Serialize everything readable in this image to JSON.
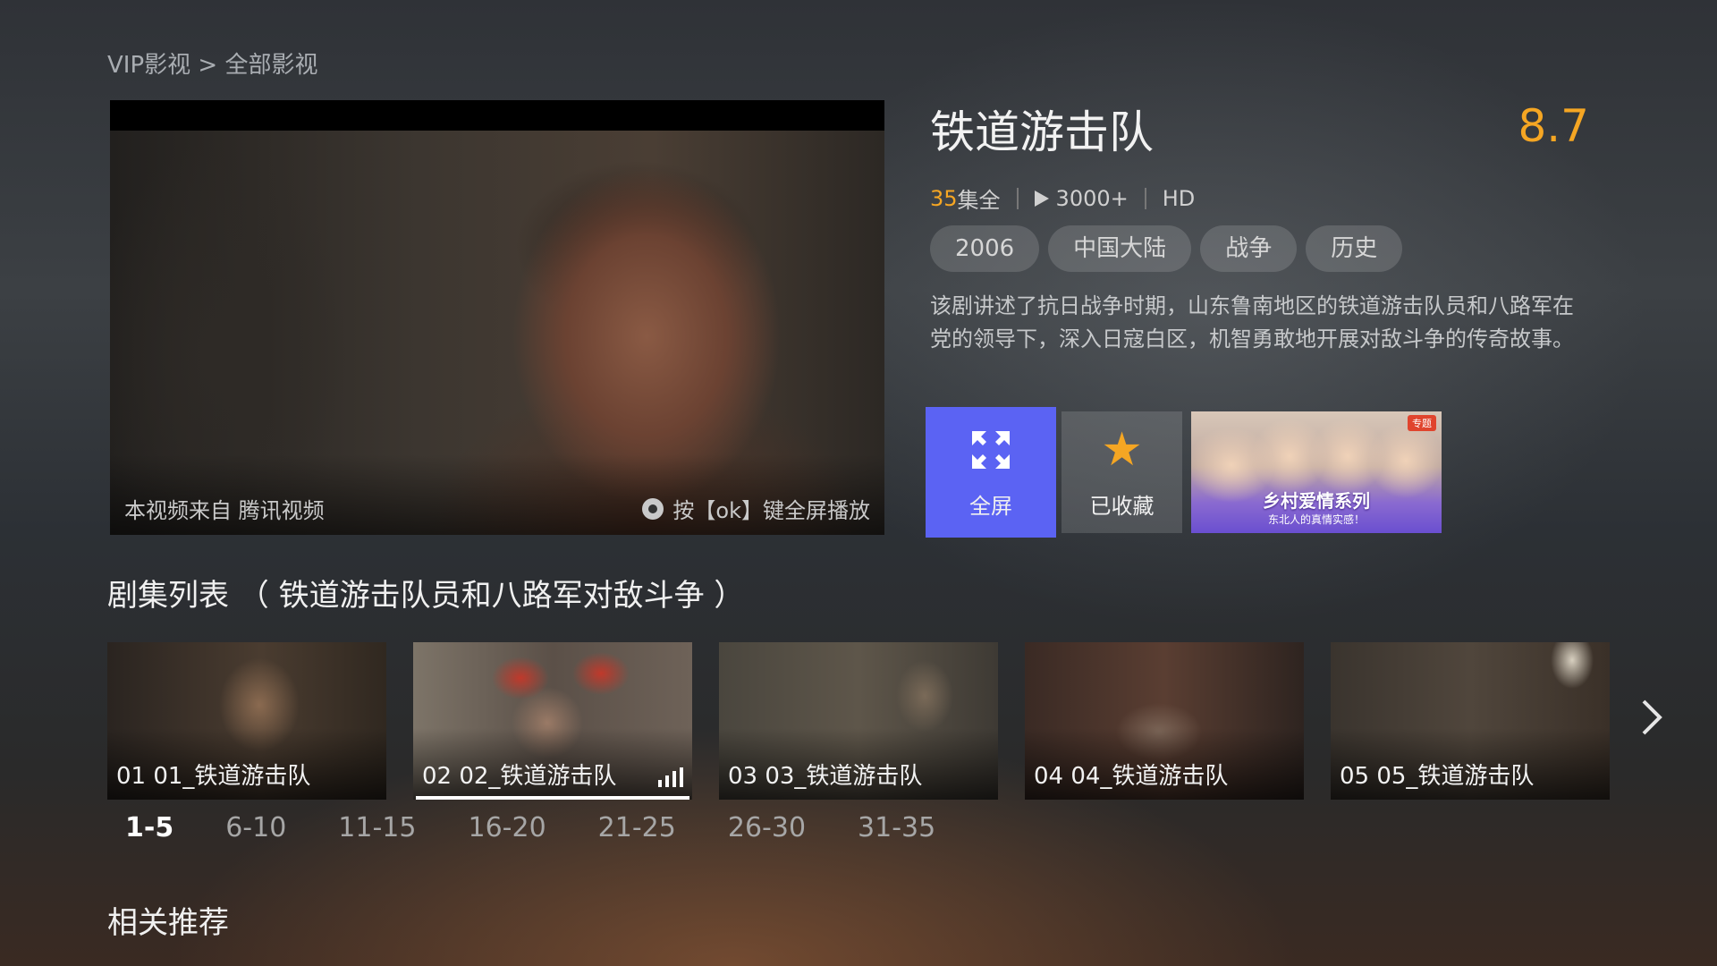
{
  "breadcrumb": "VIP影视 > 全部影视",
  "player": {
    "source_text": "本视频来自 腾讯视频",
    "hint_text": "按【ok】键全屏播放"
  },
  "show": {
    "title": "铁道游击队",
    "score": "8.7",
    "episode_count": "35",
    "episode_suffix": "集全",
    "plays": "3000+",
    "quality": "HD",
    "tags": [
      "2006",
      "中国大陆",
      "战争",
      "历史"
    ],
    "description": "该剧讲述了抗日战争时期，山东鲁南地区的铁道游击队员和八路军在党的领导下，深入日寇白区，机智勇敢地开展对敌斗争的传奇故事。"
  },
  "actions": {
    "fullscreen_label": "全屏",
    "favorite_label": "已收藏"
  },
  "promo": {
    "badge": "专题",
    "title": "乡村爱情系列",
    "subtitle": "东北人的真情实感！"
  },
  "episode_section": {
    "title": "剧集列表 （ 铁道游击队员和八路军对敌斗争 ）",
    "episodes": [
      {
        "label": "01 01_铁道游击队"
      },
      {
        "label": "02 02_铁道游击队",
        "playing": true
      },
      {
        "label": "03 03_铁道游击队"
      },
      {
        "label": "04 04_铁道游击队"
      },
      {
        "label": "05 05_铁道游击队"
      }
    ],
    "ranges": [
      "1-5",
      "6-10",
      "11-15",
      "16-20",
      "21-25",
      "26-30",
      "31-35"
    ],
    "active_range": "1-5"
  },
  "related_title": "相关推荐",
  "colors": {
    "accent": "#5b63f3",
    "score": "#f5a623"
  },
  "icons": {
    "fullscreen": "expand-arrows-icon",
    "favorite": "star-icon",
    "next": "chevron-right-icon",
    "ok": "ok-key-icon",
    "playing": "equalizer-icon"
  }
}
